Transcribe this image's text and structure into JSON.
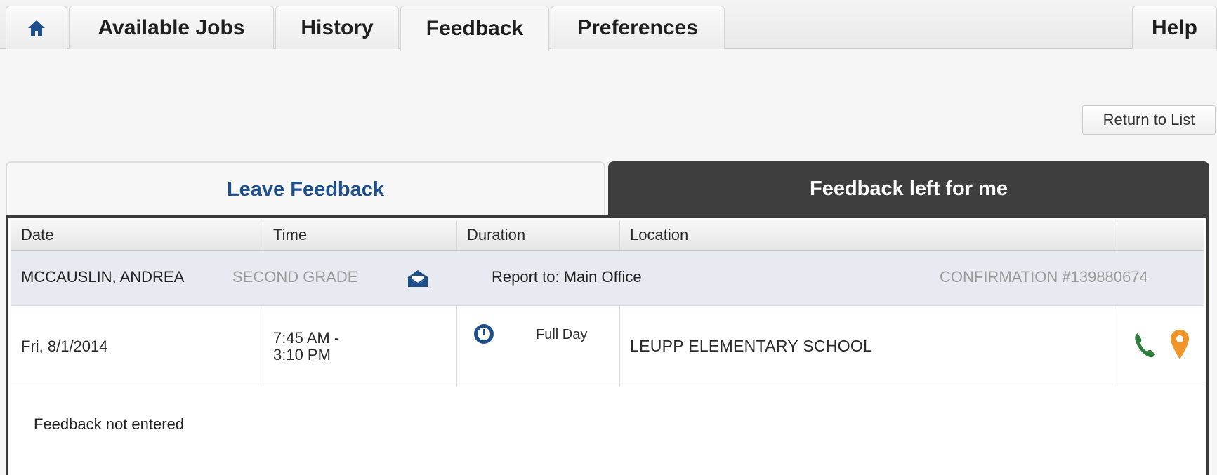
{
  "nav": {
    "tabs": [
      {
        "label": "Available Jobs"
      },
      {
        "label": "History"
      },
      {
        "label": "Feedback"
      },
      {
        "label": "Preferences"
      }
    ],
    "help": "Help",
    "home_icon": "home-icon"
  },
  "toolbar": {
    "return_label": "Return to List"
  },
  "subtabs": {
    "leave": "Leave Feedback",
    "mine": "Feedback left for me"
  },
  "table": {
    "headers": [
      "Date",
      "Time",
      "Duration",
      "Location",
      ""
    ],
    "person": {
      "name": "MCCAUSLIN, ANDREA",
      "grade": "SECOND GRADE",
      "report_to": "Report to: Main Office",
      "confirmation": "CONFIRMATION #139880674"
    },
    "job": {
      "date": "Fri, 8/1/2014",
      "time_start": "7:45 AM -",
      "time_end": "3:10 PM",
      "duration": "Full Day",
      "location": "LEUPP ELEMENTARY SCHOOL"
    },
    "feedback_status": "Feedback not entered"
  },
  "colors": {
    "nav_blue": "#1d4f8c",
    "dark_tab": "#3e3e3e",
    "phone_green": "#2e7d3a",
    "pin_orange": "#f0952a"
  }
}
